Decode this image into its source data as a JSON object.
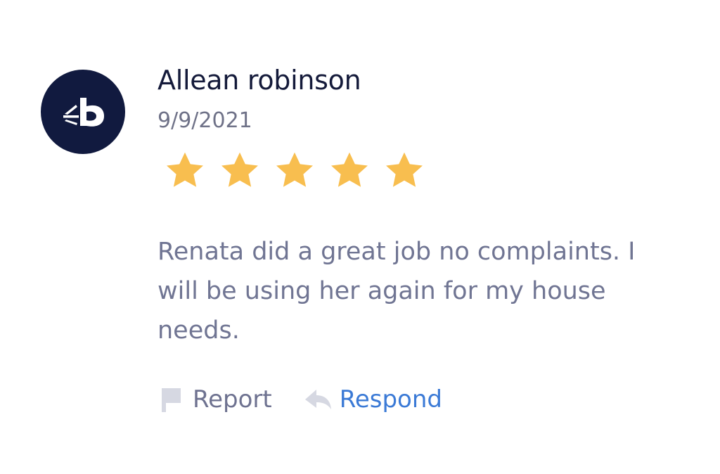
{
  "review": {
    "avatar_icon": "thumbtack-logo-icon",
    "reviewer_name": "Allean robinson",
    "date": "9/9/2021",
    "rating": 5,
    "rating_max": 5,
    "star_color": "#f8be4f",
    "text": "Renata did a great job no complaints. I will be using her again for my house needs."
  },
  "actions": {
    "report_label": "Report",
    "report_icon": "flag-icon",
    "respond_label": "Respond",
    "respond_icon": "reply-arrow-icon",
    "respond_color": "#3b7ad6"
  }
}
